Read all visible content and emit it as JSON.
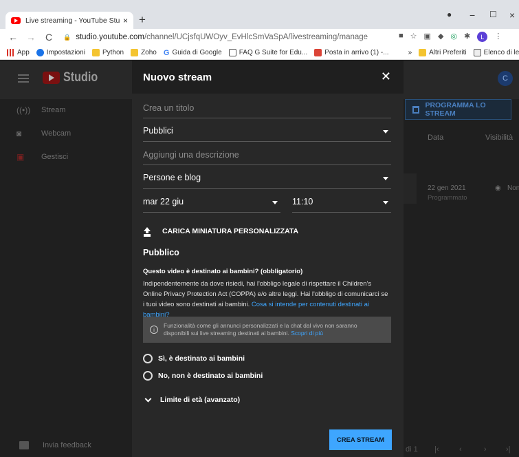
{
  "browser": {
    "tab_title": "Live streaming - YouTube Studio",
    "tab_close": "×",
    "new_tab": "+",
    "url_host": "studio.youtube.com",
    "url_path": "/channel/UCjsfqUWOyv_EvHlcSmVaSpA/livestreaming/manage",
    "profile_initial": "L",
    "bookmarks": [
      "App",
      "Impostazioni",
      "Python",
      "Zoho",
      "Guida di Google",
      "FAQ G Suite for Edu...",
      "Posta in arrivo (1) -..."
    ],
    "bookmarks_more": "»",
    "bookmarks_right": [
      "Altri Preferiti",
      "Elenco di lettura"
    ]
  },
  "studio": {
    "logo_text": "Studio",
    "avatar_initial": "C",
    "sidebar": [
      {
        "label": "Stream",
        "icon": "broadcast-icon"
      },
      {
        "label": "Webcam",
        "icon": "camera-icon"
      },
      {
        "label": "Gestisci",
        "icon": "calendar-icon"
      }
    ],
    "schedule_button": "PROGRAMMA LO STREAM",
    "columns": [
      "Data",
      "Visibilità"
    ],
    "row": {
      "date": "22 gen 2021",
      "status": "Programmato",
      "visibility": "Non"
    },
    "feedback": "Invia feedback",
    "pager_text": "di 1"
  },
  "dialog": {
    "title": "Nuovo stream",
    "title_placeholder": "Crea un titolo",
    "audience_value": "Pubblici",
    "description_placeholder": "Aggiungi una descrizione",
    "category_value": "Persone e blog",
    "date_value": "mar 22 giu",
    "time_value": "11:10",
    "upload_label": "CARICA MINIATURA PERSONALIZZATA",
    "section_title": "Pubblico",
    "question_title": "Questo video è destinato ai bambini? (obbligatorio)",
    "question_text": "Indipendentemente da dove risiedi, hai l'obbligo legale di rispettare il Children's Online Privacy Protection Act (COPPA) e/o altre leggi. Hai l'obbligo di comunicarci se i tuoi video sono destinati ai bambini.",
    "question_link": "Cosa si intende per contenuti destinati ai bambini?",
    "notice_text": "Funzionalità come gli annunci personalizzati e la chat dal vivo non saranno disponibili sui live streaming destinati ai bambini.",
    "notice_link": "Scopri di più",
    "radio_yes": "Sì, è destinato ai bambini",
    "radio_no": "No, non è destinato ai bambini",
    "age_label": "Limite di età (avanzato)",
    "create_button": "CREA STREAM",
    "close_label": "✕"
  }
}
